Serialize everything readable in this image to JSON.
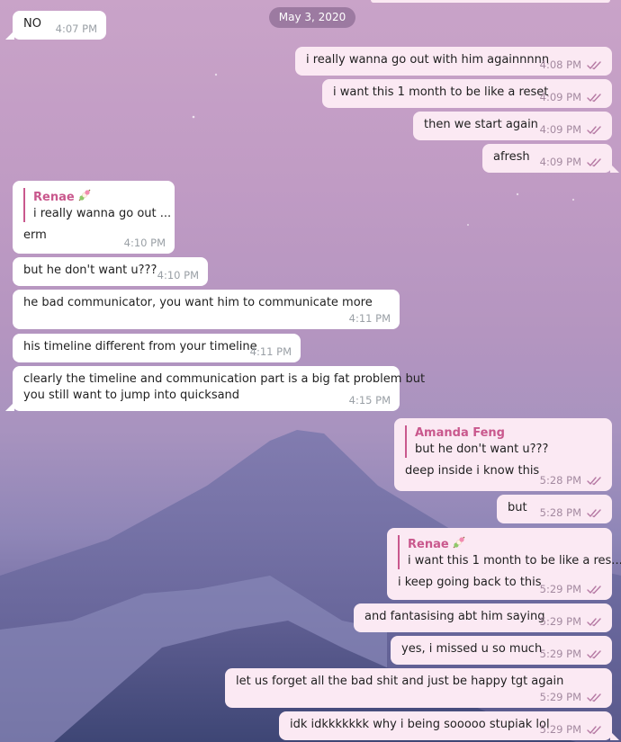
{
  "date_separator": "May 3, 2020",
  "messages": [
    {
      "text": "NO",
      "time": "4:07 PM"
    },
    {
      "text": "i really wanna go out with him againnnnn",
      "time": "4:08 PM"
    },
    {
      "text": "i want this 1 month to be like a reset",
      "time": "4:09 PM"
    },
    {
      "text": "then we start again",
      "time": "4:09 PM"
    },
    {
      "text": "afresh",
      "time": "4:09 PM"
    },
    {
      "reply_name": "Renae",
      "reply_text": "i really wanna go out ...",
      "text": "erm",
      "time": "4:10 PM"
    },
    {
      "text": "but he don't want u???",
      "time": "4:10 PM"
    },
    {
      "text": "he bad communicator, you want him to communicate more",
      "time": "4:11 PM"
    },
    {
      "text": "his timeline different from your timeline",
      "time": "4:11 PM"
    },
    {
      "line1": "clearly the timeline and communication part is a big fat problem but",
      "line2": "you still want to jump into quicksand",
      "time": "4:15 PM"
    },
    {
      "reply_name": "Amanda Feng",
      "reply_text": "but he don't want u???",
      "text": "deep inside i know this",
      "time": "5:28 PM"
    },
    {
      "text": "but",
      "time": "5:28 PM"
    },
    {
      "reply_name": "Renae",
      "reply_text": "i want this 1 month to be like a res...",
      "text": "i keep going back to this",
      "time": "5:29 PM"
    },
    {
      "text": "and fantasising abt him saying",
      "time": "5:29 PM"
    },
    {
      "text": "yes, i missed u so much",
      "time": "5:29 PM"
    },
    {
      "text": "let us forget all the bad shit and just be happy tgt again",
      "time": "5:29 PM"
    },
    {
      "text": "idk idkkkkkkk why i being sooooo stupiak lol",
      "time": "5:29 PM"
    }
  ],
  "icons": {
    "read_receipt": "double-check-icon",
    "reply_emoji": "dango-emoji-icon"
  },
  "colors": {
    "accent": "#c9588d",
    "outgoing_bubble": "#fbe9f3",
    "incoming_bubble": "#ffffff"
  }
}
